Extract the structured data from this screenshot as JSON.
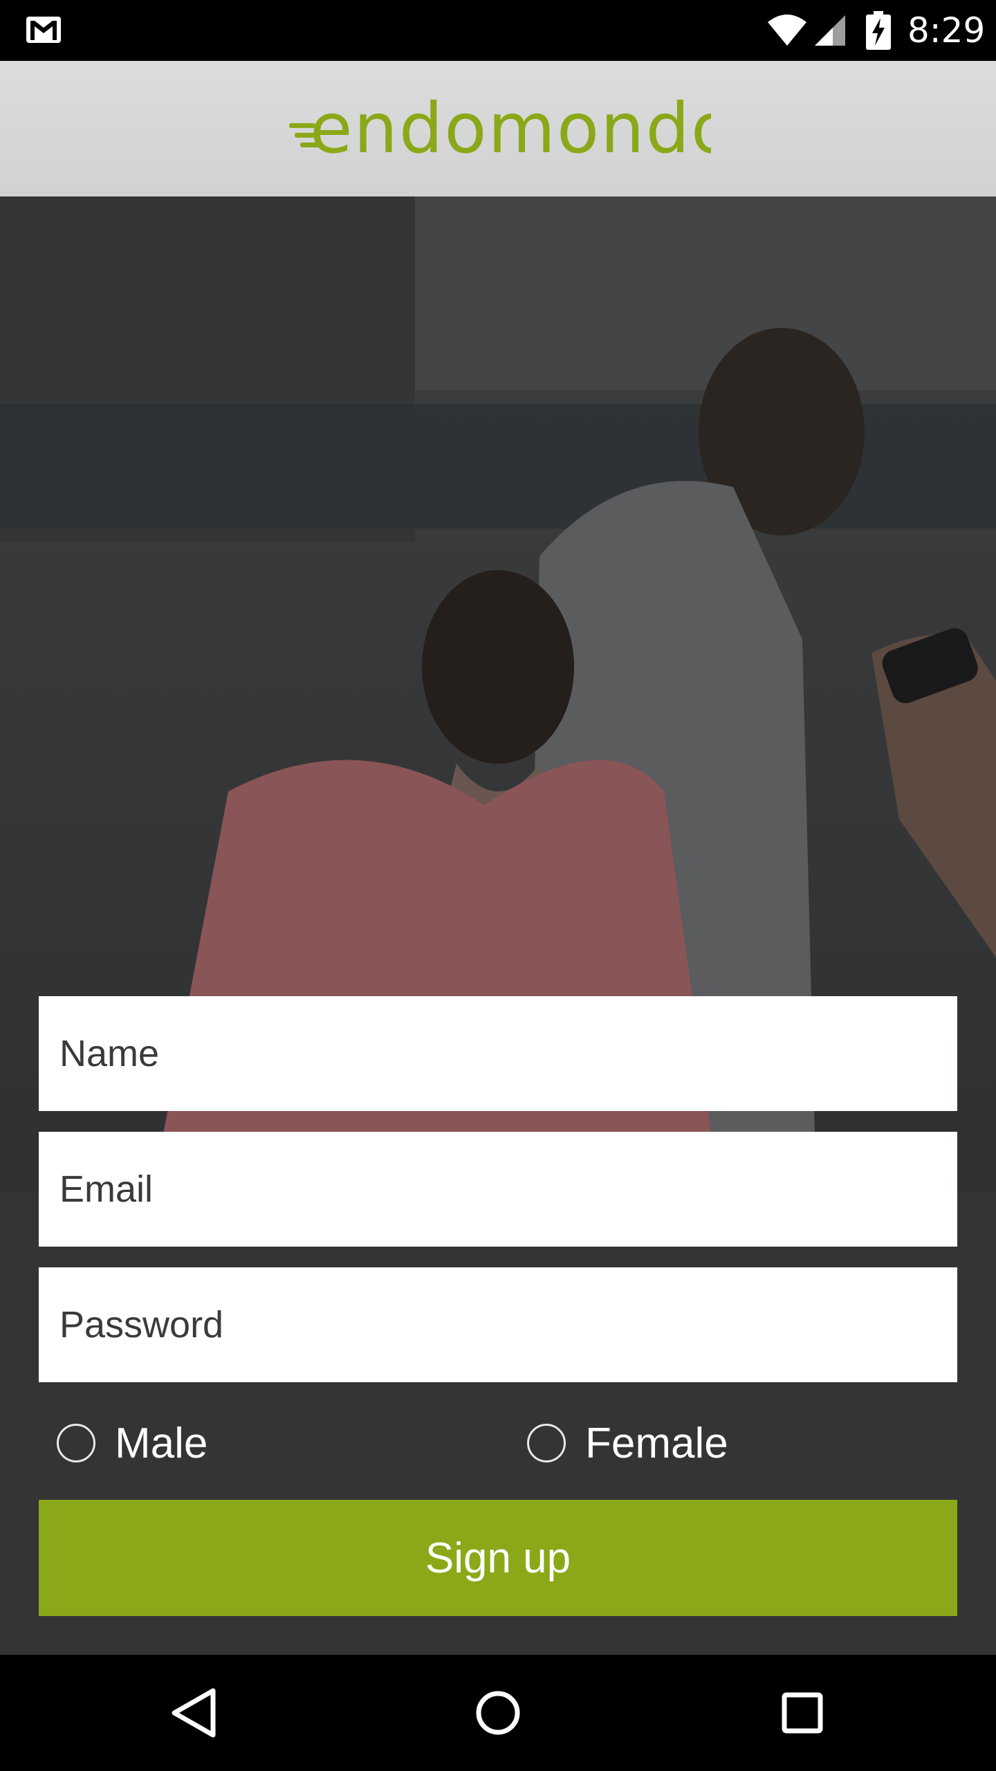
{
  "status_bar": {
    "time": "8:29",
    "icons": [
      "gmail-icon",
      "wifi-icon",
      "signal-icon",
      "battery-charging-icon"
    ]
  },
  "header": {
    "logo_text": "endomondo",
    "logo_color": "#8aa818"
  },
  "form": {
    "name_placeholder": "Name",
    "email_placeholder": "Email",
    "password_placeholder": "Password",
    "gender": {
      "male_label": "Male",
      "female_label": "Female"
    },
    "signup_label": "Sign up"
  },
  "colors": {
    "accent": "#8aa818",
    "background": "#343434"
  },
  "nav_bar": {
    "icons": [
      "back-icon",
      "home-icon",
      "recents-icon"
    ]
  }
}
